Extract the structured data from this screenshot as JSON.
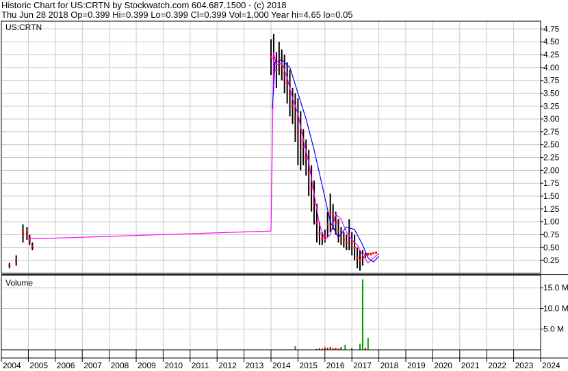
{
  "header": {
    "line1": "Historic Chart for US:CRTN by Stockwatch.com 604.687.1500 - (c) 2018",
    "line2": "Thu Jun 28 2018  Op=0.399  Hi=0.399  Lo=0.399  Cl=0.399  Vol=1,000  Year hi=4.65  lo=0.05"
  },
  "colors": {
    "price_bar": "#000000",
    "close_marker": "#ff0000",
    "fast_ma": "#ff00ff",
    "slow_ma": "#0000ff",
    "volume_bar": "#00a000",
    "volume_small_bar": "#cc0000",
    "grid": "#c8c8c8"
  },
  "chart_data": [
    {
      "type": "line",
      "title": "US:CRTN",
      "ylim": [
        0.0,
        4.9
      ],
      "y_ticks": [
        "0.25",
        "0.50",
        "0.75",
        "1.00",
        "1.25",
        "1.50",
        "1.75",
        "2.00",
        "2.25",
        "2.50",
        "2.75",
        "3.00",
        "3.25",
        "3.50",
        "3.75",
        "4.00",
        "4.25",
        "4.50",
        "4.75"
      ],
      "x_ticks": [
        "2004",
        "2005",
        "2006",
        "2007",
        "2008",
        "2009",
        "2010",
        "2011",
        "2012",
        "2013",
        "2014",
        "2015",
        "2016",
        "2017",
        "2018",
        "2019",
        "2020",
        "2021",
        "2022",
        "2023",
        "2024"
      ],
      "grid": true,
      "series": [
        {
          "kind": "high_low_bars",
          "x": [
            2004.3,
            2004.55,
            2004.8,
            2004.95,
            2005.05,
            2005.15,
            2014.0,
            2014.1,
            2014.2,
            2014.3,
            2014.4,
            2014.5,
            2014.6,
            2014.7,
            2014.8,
            2014.9,
            2015.0,
            2015.1,
            2015.2,
            2015.3,
            2015.4,
            2015.5,
            2015.6,
            2015.7,
            2015.8,
            2015.9,
            2016.0,
            2016.1,
            2016.2,
            2016.3,
            2016.4,
            2016.5,
            2016.6,
            2016.7,
            2016.8,
            2016.9,
            2017.0,
            2017.1,
            2017.2,
            2017.3,
            2017.4,
            2017.5,
            2017.6,
            2017.7,
            2017.8,
            2017.9
          ],
          "high": [
            0.2,
            0.35,
            0.95,
            0.9,
            0.75,
            0.6,
            4.55,
            4.65,
            4.3,
            4.5,
            4.35,
            4.25,
            4.1,
            3.95,
            3.6,
            3.5,
            3.4,
            3.15,
            2.8,
            2.6,
            2.4,
            2.1,
            1.8,
            1.35,
            1.0,
            0.8,
            0.85,
            1.2,
            1.55,
            1.35,
            1.2,
            1.05,
            0.9,
            0.8,
            0.75,
            1.05,
            0.8,
            0.75,
            0.5,
            0.45,
            0.45,
            0.4,
            0.4,
            0.4,
            0.4,
            0.4
          ],
          "low": [
            0.1,
            0.15,
            0.6,
            0.65,
            0.55,
            0.45,
            3.85,
            3.7,
            3.6,
            3.85,
            3.75,
            3.5,
            3.3,
            3.05,
            2.9,
            2.55,
            2.1,
            2.0,
            2.1,
            1.9,
            1.5,
            1.2,
            0.95,
            0.6,
            0.55,
            0.55,
            0.6,
            0.7,
            0.8,
            0.85,
            0.75,
            0.6,
            0.55,
            0.5,
            0.45,
            0.45,
            0.35,
            0.25,
            0.1,
            0.05,
            0.15,
            0.3,
            0.35,
            0.35,
            0.38,
            0.399
          ]
        },
        {
          "name": "",
          "kind": "line",
          "color_key": "fast_ma",
          "x": [
            2005.0,
            2005.2,
            2014.0,
            2014.1,
            2014.2,
            2014.4,
            2014.6,
            2014.8,
            2015.0,
            2015.2,
            2015.4,
            2015.6,
            2015.8,
            2016.0,
            2016.2,
            2016.4,
            2016.6,
            2016.8,
            2017.0,
            2017.2,
            2017.4,
            2017.6,
            2017.8,
            2018.0
          ],
          "y": [
            0.7,
            0.67,
            0.82,
            4.3,
            4.05,
            4.1,
            3.8,
            3.4,
            3.1,
            2.6,
            2.15,
            1.55,
            0.95,
            0.65,
            0.75,
            1.15,
            1.05,
            0.8,
            0.65,
            0.55,
            0.35,
            0.2,
            0.3,
            0.38
          ]
        },
        {
          "name": "",
          "kind": "line",
          "color_key": "slow_ma",
          "x": [
            2014.05,
            2014.15,
            2014.4,
            2014.7,
            2015.0,
            2015.3,
            2015.6,
            2015.9,
            2016.2,
            2016.5,
            2016.8,
            2017.1,
            2017.4,
            2017.6,
            2017.8,
            2018.0
          ],
          "y": [
            3.2,
            4.1,
            4.15,
            4.0,
            3.5,
            3.0,
            2.4,
            1.7,
            1.0,
            0.7,
            0.9,
            0.85,
            0.55,
            0.3,
            0.22,
            0.33
          ]
        }
      ]
    },
    {
      "type": "bar",
      "title": "Volume",
      "ylim": [
        0,
        18000000
      ],
      "y_ticks": [
        "5.0 M",
        "10.0 M",
        "15.0 M"
      ],
      "grid": true,
      "x": [
        2014.9,
        2015.7,
        2015.8,
        2015.9,
        2016.0,
        2016.1,
        2016.2,
        2016.3,
        2016.4,
        2016.5,
        2016.6,
        2016.75,
        2017.0,
        2017.3,
        2017.4,
        2017.5,
        2017.6
      ],
      "values": [
        900000,
        200000,
        400000,
        300000,
        600000,
        500000,
        700000,
        400000,
        500000,
        300000,
        600000,
        1200000,
        400000,
        1500000,
        17000000,
        500000,
        2800000
      ]
    }
  ]
}
